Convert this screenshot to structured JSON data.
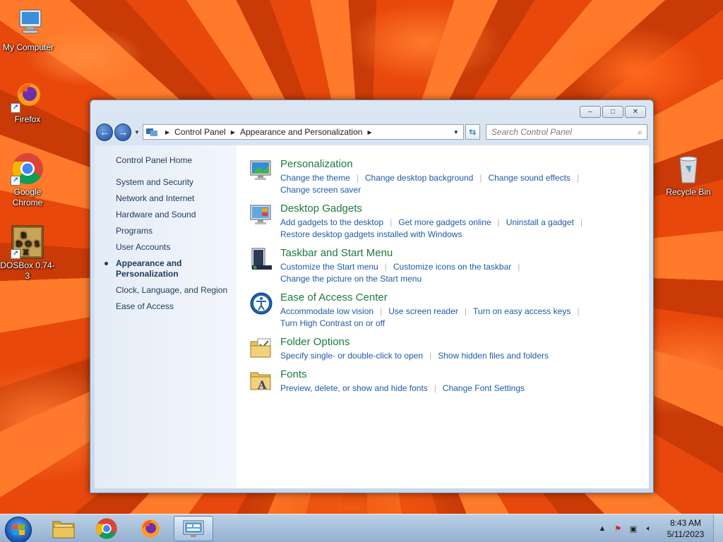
{
  "desktop": {
    "icons": [
      {
        "label": "My Computer",
        "icon": "computer-icon"
      },
      {
        "label": "Firefox",
        "icon": "firefox-icon"
      },
      {
        "label": "Google Chrome",
        "icon": "chrome-icon"
      },
      {
        "label": "DOSBox 0.74-3",
        "icon": "dosbox-icon"
      },
      {
        "label": "Recycle Bin",
        "icon": "recycle-bin-icon"
      }
    ]
  },
  "window": {
    "controls": {
      "minimize": "–",
      "maximize": "□",
      "close": "✕"
    },
    "nav": {
      "back": "←",
      "forward": "→",
      "breadcrumb": [
        "Control Panel",
        "Appearance and Personalization"
      ],
      "search_placeholder": "Search Control Panel"
    },
    "left_pane": {
      "home": "Control Panel Home",
      "items": [
        "System and Security",
        "Network and Internet",
        "Hardware and Sound",
        "Programs",
        "User Accounts",
        "Appearance and Personalization",
        "Clock, Language, and Region",
        "Ease of Access"
      ],
      "active_index": 5
    },
    "categories": [
      {
        "title": "Personalization",
        "icon": "personalization-icon",
        "links": [
          "Change the theme",
          "Change desktop background",
          "Change sound effects"
        ],
        "links2": [
          "Change screen saver"
        ]
      },
      {
        "title": "Desktop Gadgets",
        "icon": "gadgets-icon",
        "links": [
          "Add gadgets to the desktop",
          "Get more gadgets online",
          "Uninstall a gadget"
        ],
        "links2": [
          "Restore desktop gadgets installed with Windows"
        ]
      },
      {
        "title": "Taskbar and Start Menu",
        "icon": "taskbar-icon",
        "links": [
          "Customize the Start menu",
          "Customize icons on the taskbar"
        ],
        "links2": [
          "Change the picture on the Start menu"
        ]
      },
      {
        "title": "Ease of Access Center",
        "icon": "ease-of-access-icon",
        "links": [
          "Accommodate low vision",
          "Use screen reader",
          "Turn on easy access keys"
        ],
        "links2": [
          "Turn High Contrast on or off"
        ]
      },
      {
        "title": "Folder Options",
        "icon": "folder-options-icon",
        "links": [
          "Specify single- or double-click to open",
          "Show hidden files and folders"
        ],
        "links2": []
      },
      {
        "title": "Fonts",
        "icon": "fonts-icon",
        "links": [
          "Preview, delete, or show and hide fonts",
          "Change Font Settings"
        ],
        "links2": []
      }
    ]
  },
  "taskbar": {
    "time": "8:43 AM",
    "date": "5/11/2023"
  }
}
